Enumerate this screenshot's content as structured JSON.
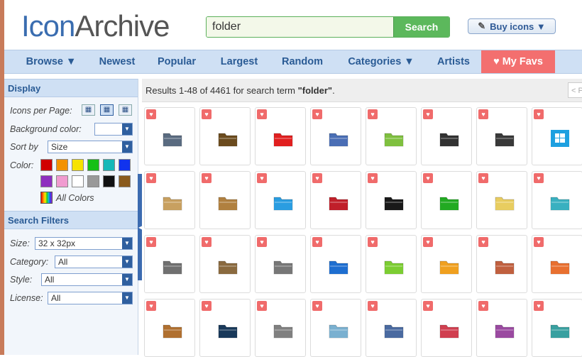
{
  "header": {
    "logo_part1": "Icon",
    "logo_part2": "Archive",
    "search_value": "folder",
    "search_button": "Search",
    "buy_icons": "Buy icons ▼"
  },
  "nav": {
    "items": [
      "Browse ▼",
      "Newest",
      "Popular",
      "Largest",
      "Random",
      "Categories ▼",
      "Artists",
      "♥ My Favs"
    ]
  },
  "sidebar": {
    "display_title": "Display",
    "icons_per_page_label": "Icons per Page:",
    "background_color_label": "Background color:",
    "sort_by_label": "Sort by",
    "sort_by_value": "Size",
    "color_label": "Color:",
    "all_colors": "All Colors",
    "colors": [
      "#d10000",
      "#f39200",
      "#f7e300",
      "#16c016",
      "#15b8b8",
      "#1133ee",
      "#8e2fbf",
      "#f09bd0",
      "#ffffff",
      "#999999",
      "#111111",
      "#8a5a1c"
    ],
    "search_filters_title": "Search Filters",
    "size_label": "Size:",
    "size_value": "32 x 32px",
    "category_label": "Category:",
    "category_value": "All",
    "style_label": "Style:",
    "style_value": "All",
    "license_label": "License:",
    "license_value": "All"
  },
  "results": {
    "prefix": "Results 1-48 of 4461 for search term ",
    "term": "\"folder\"",
    "suffix": ".",
    "page_indicator": "< P"
  },
  "icons": [
    {
      "name": "folder-icon",
      "color": "#5a6b80"
    },
    {
      "name": "folder-icon",
      "color": "#6b4b1e"
    },
    {
      "name": "folder-icon",
      "color": "#e02020"
    },
    {
      "name": "folder-icon",
      "color": "#4a6fb5"
    },
    {
      "name": "folder-icon",
      "color": "#7fbf3f"
    },
    {
      "name": "folder-icon",
      "color": "#333333"
    },
    {
      "name": "folder-icon",
      "color": "#3a3a3a"
    },
    {
      "name": "windows-icon",
      "color": "#1ea0e0"
    },
    {
      "name": "folder-icon",
      "color": "#c8a060"
    },
    {
      "name": "folder-icon",
      "color": "#b08040"
    },
    {
      "name": "folder-icon",
      "color": "#2a9de0"
    },
    {
      "name": "folder-icon",
      "color": "#c0202a"
    },
    {
      "name": "folder-icon",
      "color": "#1a1a1a"
    },
    {
      "name": "folder-icon",
      "color": "#22aa22"
    },
    {
      "name": "folder-icon",
      "color": "#e8cc60"
    },
    {
      "name": "folder-icon",
      "color": "#3ab0c0"
    },
    {
      "name": "folder-icon",
      "color": "#707070"
    },
    {
      "name": "folder-icon",
      "color": "#8a6a40"
    },
    {
      "name": "folder-icon",
      "color": "#777777"
    },
    {
      "name": "folder-icon",
      "color": "#1f6fd0"
    },
    {
      "name": "folder-icon",
      "color": "#7ccc33"
    },
    {
      "name": "folder-icon",
      "color": "#f0a020"
    },
    {
      "name": "folder-icon",
      "color": "#c06040"
    },
    {
      "name": "folder-icon",
      "color": "#e87030"
    },
    {
      "name": "folder-icon",
      "color": "#b07030"
    },
    {
      "name": "folder-icon",
      "color": "#1a3a5a"
    },
    {
      "name": "folder-icon",
      "color": "#808080"
    },
    {
      "name": "folder-icon",
      "color": "#7ab0d0"
    },
    {
      "name": "folder-icon",
      "color": "#4a6aa0"
    },
    {
      "name": "folder-icon",
      "color": "#d04050"
    },
    {
      "name": "folder-icon",
      "color": "#9a4aa0"
    },
    {
      "name": "folder-icon",
      "color": "#3aa0a0"
    }
  ]
}
